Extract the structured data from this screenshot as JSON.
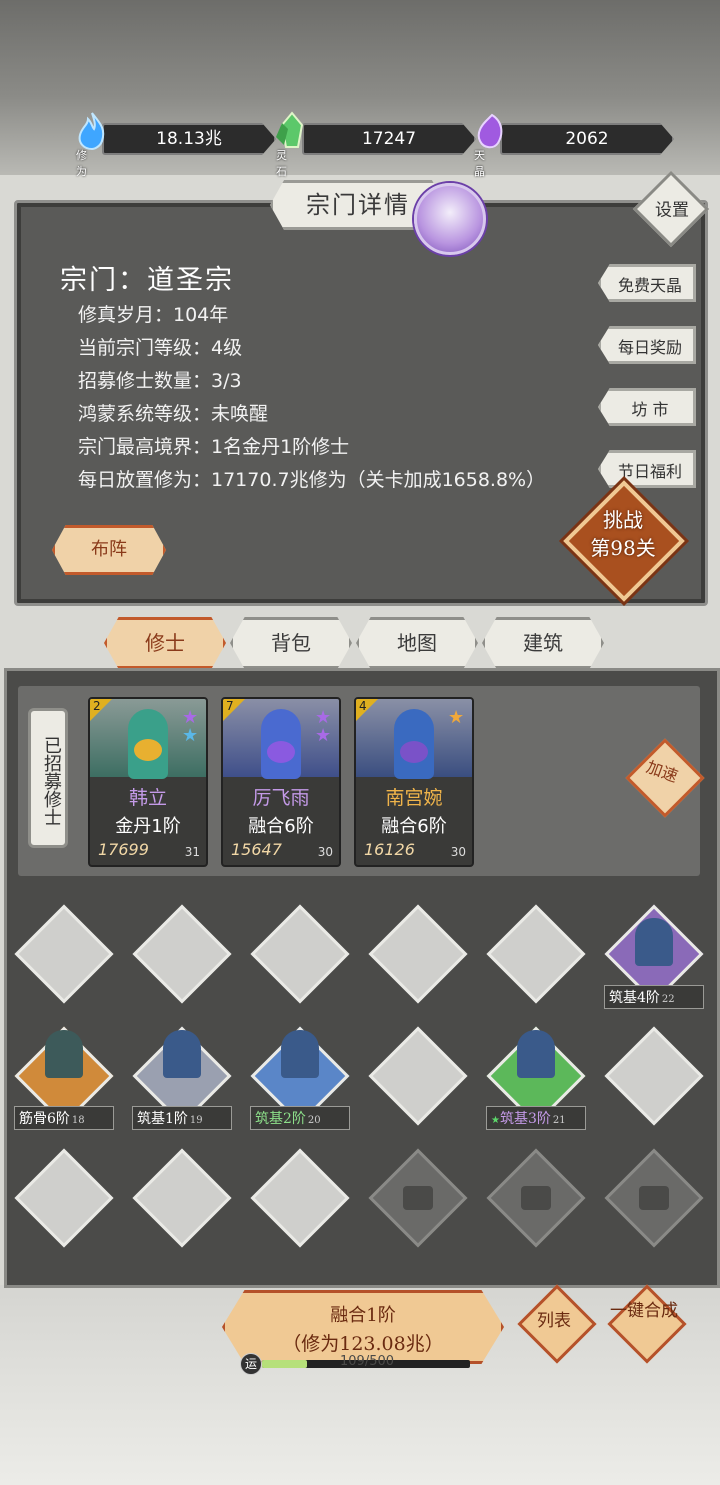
{
  "resources": [
    {
      "value": "18.13兆",
      "label": "修为",
      "color": "#4fb6ff"
    },
    {
      "value": "17247",
      "label": "灵石",
      "color": "#5cc86a"
    },
    {
      "value": "2062",
      "label": "天晶",
      "color": "#a05ae0"
    }
  ],
  "panel": {
    "title": "宗门详情",
    "settings": "设置",
    "sect_name": "宗门：道圣宗",
    "lines": [
      "修真岁月：104年",
      "当前宗门等级：4级",
      "招募修士数量：3/3",
      "鸿蒙系统等级：未唤醒",
      "宗门最高境界：1名金丹1阶修士",
      "每日放置修为：17170.7兆修为（关卡加成1658.8%）"
    ],
    "side_buttons": [
      "免费天晶",
      "每日奖励",
      "坊 市",
      "节日福利"
    ],
    "formation": "布阵",
    "challenge_line1": "挑战",
    "challenge_line2": "第98关"
  },
  "tabs": [
    "修士",
    "背包",
    "地图",
    "建筑"
  ],
  "recruit_label": "已招募修士",
  "cards": [
    {
      "num": "2",
      "name": "韩立",
      "name_color": "#c49ae8",
      "rank": "金丹1阶",
      "power": "17699",
      "level": "31",
      "color": "#3aa08a",
      "stars": [
        "#a86ae6",
        "#5ab8e8"
      ]
    },
    {
      "num": "7",
      "name": "厉飞雨",
      "name_color": "#c49ae8",
      "rank": "融合6阶",
      "power": "15647",
      "level": "30",
      "color": "#4a6ad0",
      "stars": [
        "#a86ae6",
        "#a86ae6"
      ]
    },
    {
      "num": "4",
      "name": "南宫婉",
      "name_color": "#f0b44a",
      "rank": "融合6阶",
      "power": "16126",
      "level": "30",
      "color": "#3a6ac0",
      "stars": [
        "#f0a83a"
      ]
    }
  ],
  "speed_up": "加速",
  "grid_labels": [
    {
      "text": "筑基4阶",
      "level": "22",
      "color": "#ffffff"
    },
    {
      "text": "筋骨6阶",
      "level": "18",
      "color": "#ffffff"
    },
    {
      "text": "筑基1阶",
      "level": "19",
      "color": "#ffffff"
    },
    {
      "text": "筑基2阶",
      "level": "20",
      "color": "#8de08a"
    },
    {
      "text": "筑基3阶",
      "level": "21",
      "color": "#c49ae8"
    }
  ],
  "merge": {
    "line1": "融合1阶",
    "line2": "（修为123.08兆）"
  },
  "list_btn": "列表",
  "auto_merge": "一键合成",
  "luck": {
    "icon": "运",
    "text": "109/500",
    "progress": 0.218
  }
}
